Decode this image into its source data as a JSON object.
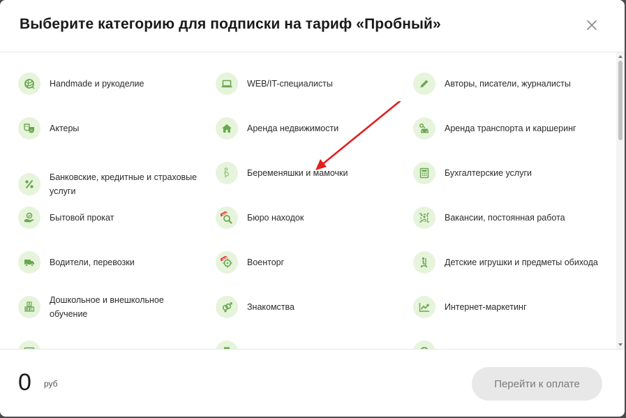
{
  "modal": {
    "title": "Выберите категорию для подписки на тариф «Пробный»",
    "close_icon": "close-icon"
  },
  "categories": [
    {
      "label": "Handmade и рукоделие",
      "icon": "yarn-icon"
    },
    {
      "label": "WEB/IT-специалисты",
      "icon": "laptop-icon"
    },
    {
      "label": "Авторы, писатели, журналисты",
      "icon": "pencil-icon"
    },
    {
      "label": "Актеры",
      "icon": "theater-masks-icon"
    },
    {
      "label": "Аренда недвижимости",
      "icon": "house-icon"
    },
    {
      "label": "Аренда транспорта и каршеринг",
      "icon": "car-key-icon"
    },
    {
      "label": "Банковские, кредитные и страховые услуги",
      "icon": "percent-icon"
    },
    {
      "label": "Беременяшки и мамочки",
      "icon": "pregnant-icon"
    },
    {
      "label": "Бухгалтерские услуги",
      "icon": "calculator-icon"
    },
    {
      "label": "Бытовой прокат",
      "icon": "hand-coin-icon"
    },
    {
      "label": "Бюро находок",
      "icon": "magnifier-new-icon"
    },
    {
      "label": "Вакансии, постоянная работа",
      "icon": "recruit-icon"
    },
    {
      "label": "Водители, перевозки",
      "icon": "truck-icon"
    },
    {
      "label": "Военторг",
      "icon": "crosshair-new-icon"
    },
    {
      "label": "Детские игрушки и предметы обихода",
      "icon": "scooter-icon"
    },
    {
      "label": "Дошкольное и внешкольное обучение",
      "icon": "abc-blocks-icon"
    },
    {
      "label": "Знакомства",
      "icon": "gender-icon"
    },
    {
      "label": "Интернет-маркетинг",
      "icon": "chart-line-icon"
    },
    {
      "label": "",
      "icon": "monitor-icon"
    },
    {
      "label": "",
      "icon": "printer-icon"
    },
    {
      "label": "",
      "icon": "globe-icon"
    }
  ],
  "badges": {
    "new": "NEW"
  },
  "footer": {
    "price": "0",
    "currency": "руб",
    "pay_button": "Перейти к оплате"
  },
  "colors": {
    "icon_bg": "#e7f4dc",
    "icon_fg": "#6aa84f",
    "arrow": "#e02020",
    "badge": "#e53935"
  }
}
